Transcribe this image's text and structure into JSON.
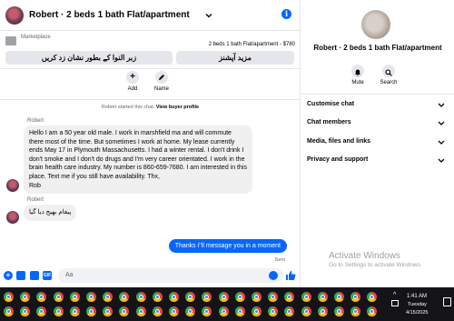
{
  "header": {
    "title": "Robert · 2 beds 1 bath Flat/apartment"
  },
  "marketplace": {
    "label": "Marketplace",
    "listing": "2 beds 1 bath Flat/apartment - $780",
    "btn_mark": "زبر النوا کے بطور نشان زد کریں",
    "btn_more": "مزید آپشنز"
  },
  "actions": {
    "add": "Add",
    "name": "Name"
  },
  "chat": {
    "started_prefix": "Robert started this chat.",
    "started_link": "View buyer profile",
    "sender1": "Robert",
    "msg1": "Hello I am a 50 year old male.  I work in marshfield ma and will commute there most of the time. But sometimes I work at home.  My lease currently ends May 17 in Plymouth  Massachusetts.  I had a winter rental.  I don't drink I don't smoke and I don't do drugs and I'm very career orientated.  I work in the brain health care industry.  My number is 860-659-7680.  I am interested in this place.  Text me if you still have availability.  Thx,",
    "msg1_sign": "Rob",
    "sender2": "Robert",
    "msg2": "پیغام بھیج دیا گیا",
    "msg_out": "Thanks i''ll message you in a moment",
    "sent": "Sent",
    "placeholder": "Aa"
  },
  "side": {
    "name": "Robert · 2 beds 1 bath Flat/apartment",
    "mute": "Mute",
    "search": "Search",
    "rows": [
      "Customise chat",
      "Chat members",
      "Media, files and links",
      "Privacy and support"
    ]
  },
  "watermark": {
    "line1": "Activate Windows",
    "line2": "Go to Settings to activate Windows."
  },
  "tray": {
    "time": "1:41 AM",
    "day": "Tuesday",
    "date": "4/15/2025"
  },
  "colors": {
    "accent": "#0866ff",
    "bubble_in": "#f0f0f0",
    "taskbar": "#141418"
  }
}
